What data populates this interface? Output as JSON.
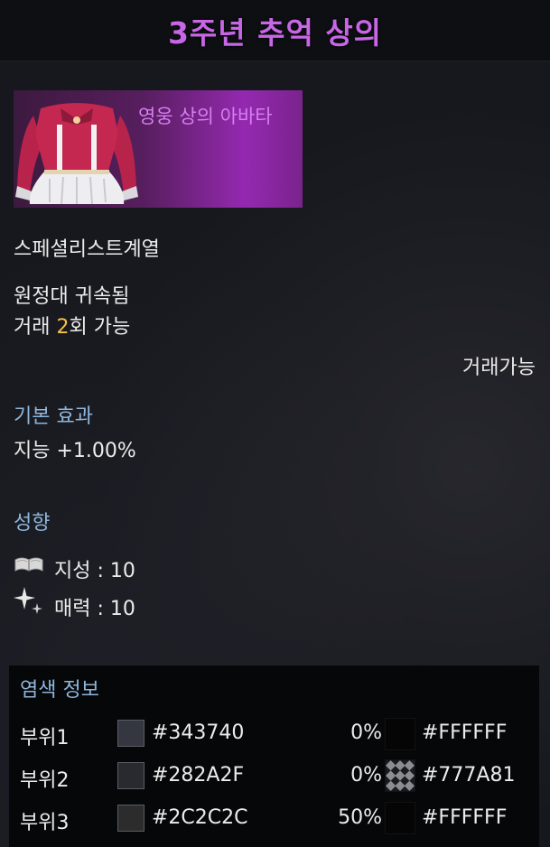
{
  "item": {
    "title": "3주년 추억 상의",
    "grade_label": "영웅 상의 아바타",
    "class_line": "스페셜리스트계열",
    "bind": "원정대 귀속됨",
    "trade_prefix": "거래 ",
    "trade_count": "2",
    "trade_suffix": "회 가능",
    "tradeable": "거래가능"
  },
  "base_effect": {
    "heading": "기본 효과",
    "stat": "지능 +1.00%"
  },
  "tendency": {
    "heading": "성향",
    "items": [
      {
        "icon": "book-icon",
        "label": "지성 : 10"
      },
      {
        "icon": "sparkle-icon",
        "label": "매력 : 10"
      }
    ]
  },
  "dye": {
    "heading": "염색 정보",
    "rows": [
      {
        "part": "부위1",
        "color": "#343740",
        "percent": "0%",
        "pattern_color": "#FFFFFF",
        "pattern": "none"
      },
      {
        "part": "부위2",
        "color": "#282A2F",
        "percent": "0%",
        "pattern_color": "#777A81",
        "pattern": "diamond-pattern"
      },
      {
        "part": "부위3",
        "color": "#2C2C2C",
        "percent": "50%",
        "pattern_color": "#FFFFFF",
        "pattern": "none"
      }
    ]
  },
  "colors": {
    "title": "#c867e6",
    "heading": "#8fb6dc",
    "highlight": "#f6c148",
    "grade": "#d77ef0"
  }
}
